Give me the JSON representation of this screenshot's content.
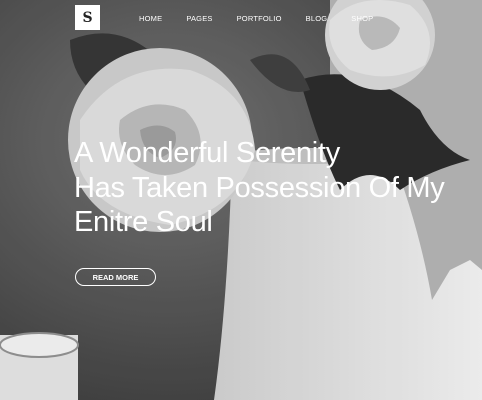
{
  "logo": {
    "letter": "S"
  },
  "nav": {
    "items": [
      "HOME",
      "PAGES",
      "PORTFOLIO",
      "BLOG",
      "SHOP"
    ]
  },
  "hero": {
    "headline_lines": [
      "A Wonderful Serenity",
      "Has Taken Possession Of My",
      "Enitre Soul"
    ],
    "button_label": "READ MORE"
  }
}
